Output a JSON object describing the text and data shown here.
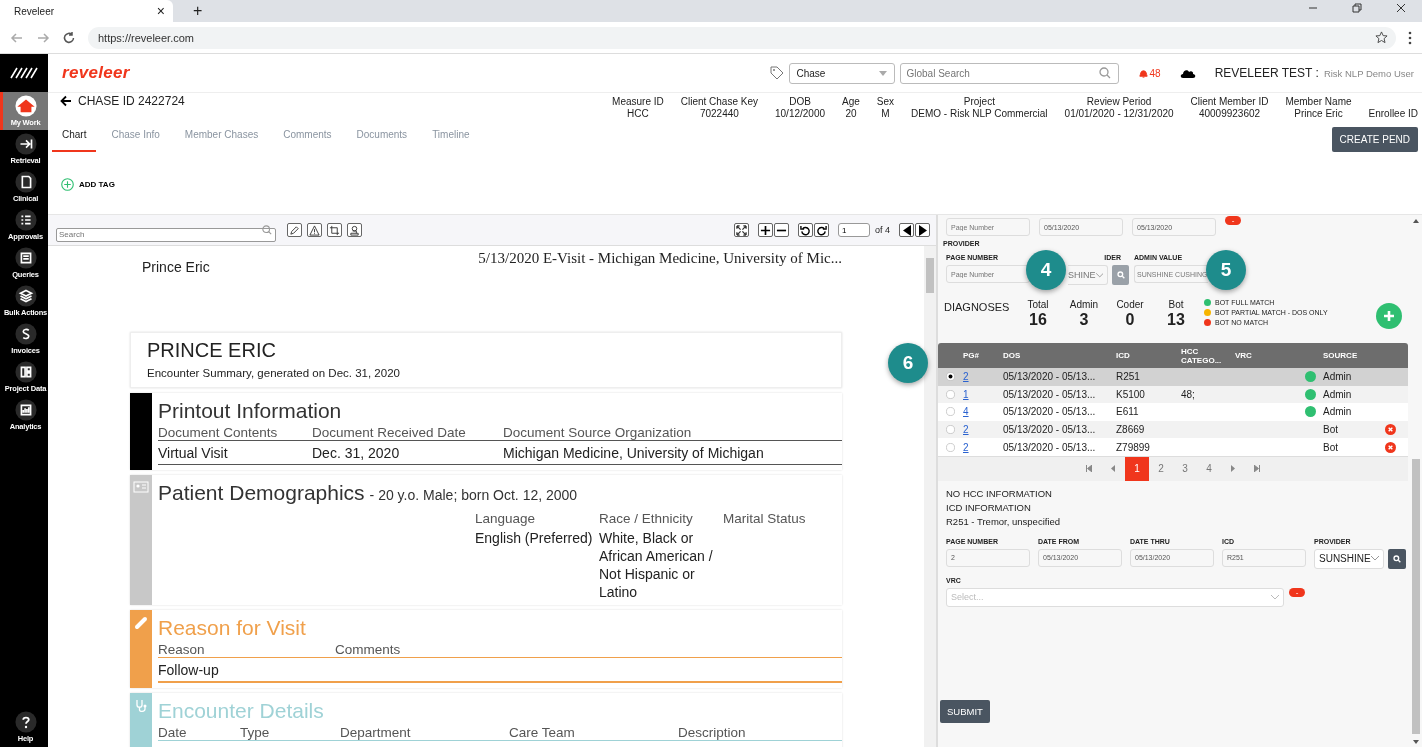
{
  "browser": {
    "tab_title": "Reveleer",
    "close": "×",
    "new_tab": "+",
    "url": "https://reveleer.com"
  },
  "sidebar": {
    "items": [
      {
        "label": "My Work",
        "selected": true
      },
      {
        "label": "Retrieval",
        "selected": false
      },
      {
        "label": "Clinical",
        "selected": false
      },
      {
        "label": "Approvals",
        "selected": false
      },
      {
        "label": "Queries",
        "selected": false
      },
      {
        "label": "Bulk Actions",
        "selected": false
      },
      {
        "label": "Invoices",
        "selected": false
      },
      {
        "label": "Project Data",
        "selected": false
      },
      {
        "label": "Analytics",
        "selected": false
      }
    ],
    "help": "Help"
  },
  "header": {
    "logo": "reveleer",
    "search_type": "Chase",
    "search_placeholder": "Global Search",
    "alert_count": "48",
    "user_org": "REVELEER TEST :",
    "user_name": "Risk NLP Demo User"
  },
  "chase": {
    "title": "CHASE ID 2422724",
    "meta": [
      {
        "label": "Measure ID",
        "value": "HCC"
      },
      {
        "label": "Client Chase Key",
        "value": "7022440"
      },
      {
        "label": "DOB",
        "value": "10/12/2000"
      },
      {
        "label": "Age",
        "value": "20"
      },
      {
        "label": "Sex",
        "value": "M"
      },
      {
        "label": "Project",
        "value": "DEMO - Risk NLP Commercial"
      },
      {
        "label": "Review Period",
        "value": "01/01/2020 - 12/31/2020"
      },
      {
        "label": "Client Member ID",
        "value": "40009923602"
      },
      {
        "label": "Member Name",
        "value": "Prince Eric"
      },
      {
        "label": "Enrollee ID"
      }
    ]
  },
  "tabs": [
    {
      "label": "Chart",
      "selected": true
    },
    {
      "label": "Chase Info",
      "selected": false
    },
    {
      "label": "Member Chases",
      "selected": false
    },
    {
      "label": "Comments",
      "selected": false
    },
    {
      "label": "Documents",
      "selected": false
    },
    {
      "label": "Timeline",
      "selected": false
    }
  ],
  "create_pend": "CREATE PEND",
  "add_tag": "ADD TAG",
  "viewer": {
    "search_placeholder": "Search",
    "page": "1",
    "page_total": "of 4"
  },
  "document": {
    "patient": "Prince Eric",
    "visit": "5/13/2020 E-Visit - Michigan Medicine, University of Mic...",
    "name": "PRINCE ERIC",
    "summary": "Encounter Summary, generated on Dec. 31, 2020",
    "sections": [
      {
        "kind": "printout",
        "title": "Printout Information",
        "color": "#000000",
        "headers": [
          "Document Contents",
          "Document Received Date",
          "Document Source Organization"
        ],
        "values": [
          "Virtual Visit",
          "Dec. 31, 2020",
          "Michigan Medicine, University of Michigan"
        ]
      },
      {
        "kind": "demographics",
        "title": "Patient Demographics",
        "subtitle": "- 20 y.o. Male; born Oct. 12, 2000",
        "color": "#c8c8c8",
        "headers": [
          "Language",
          "Race / Ethnicity",
          "Marital Status"
        ],
        "values": [
          "English (Preferred)",
          "White, Black or African American / Not Hispanic or Latino"
        ]
      },
      {
        "kind": "reason",
        "title": "Reason for Visit",
        "color": "#f0a04b",
        "headers": [
          "Reason",
          "Comments"
        ],
        "values": [
          "Follow-up"
        ]
      },
      {
        "kind": "encounter",
        "title": "Encounter Details",
        "color": "#9fd2d6",
        "headers": [
          "Date",
          "Type",
          "Department",
          "Care Team",
          "Description"
        ]
      }
    ]
  },
  "panel": {
    "top_fields": [
      {
        "placeholder": "Page Number"
      },
      {
        "value": "05/13/2020"
      },
      {
        "value": "05/13/2020"
      }
    ],
    "remove": "-",
    "provider_heading": "PROVIDER",
    "admin": {
      "page_label": "PAGE NUMBER",
      "page_placeholder": "Page Number",
      "provider_label": "IDER",
      "provider_value": "SHINE",
      "admin_label": "ADMIN VALUE",
      "admin_value": "SUNSHINE CUSHING"
    },
    "diagnoses": {
      "title": "DIAGNOSES",
      "counts": [
        {
          "label": "Total",
          "value": "16"
        },
        {
          "label": "Admin",
          "value": "3"
        },
        {
          "label": "Coder",
          "value": "0"
        },
        {
          "label": "Bot",
          "value": "13"
        }
      ],
      "legend": [
        {
          "label": "BOT FULL MATCH",
          "color": "#2fbf71"
        },
        {
          "label": "BOT PARTIAL MATCH - DOS ONLY",
          "color": "#f7b500"
        },
        {
          "label": "BOT NO MATCH",
          "color": "#f0361c"
        }
      ]
    },
    "table": {
      "columns": [
        "PG#",
        "DOS",
        "ICD",
        "HCC CATEGO...",
        "VRC",
        "SOURCE"
      ],
      "rows": [
        {
          "selected": true,
          "page": "2",
          "dos": "05/13/2020 - 05/13...",
          "icd": "R251",
          "color": "#2fbf71",
          "source": "Admin",
          "delete": false
        },
        {
          "selected": false,
          "page": "1",
          "dos": "05/13/2020 - 05/13...",
          "icd": "K5100",
          "hcc": "48;",
          "color": "#2fbf71",
          "source": "Admin",
          "delete": false
        },
        {
          "selected": false,
          "page": "4",
          "dos": "05/13/2020 - 05/13...",
          "icd": "E611",
          "color": "#2fbf71",
          "source": "Admin",
          "delete": false
        },
        {
          "selected": false,
          "page": "2",
          "dos": "05/13/2020 - 05/13...",
          "icd": "Z8669",
          "source": "Bot",
          "delete": true
        },
        {
          "selected": false,
          "page": "2",
          "dos": "05/13/2020 - 05/13...",
          "icd": "Z79899",
          "source": "Bot",
          "delete": true
        }
      ]
    },
    "pages": [
      {
        "label": "1",
        "selected": true
      },
      {
        "label": "2",
        "selected": false
      },
      {
        "label": "3",
        "selected": false
      },
      {
        "label": "4",
        "selected": false
      }
    ],
    "info": [
      "NO HCC INFORMATION",
      "ICD INFORMATION",
      "R251 - Tremor, unspecified"
    ],
    "form": {
      "fields": [
        {
          "label": "PAGE NUMBER",
          "value": "2"
        },
        {
          "label": "DATE FROM",
          "value": "05/13/2020"
        },
        {
          "label": "DATE THRU",
          "value": "05/13/2020"
        },
        {
          "label": "ICD",
          "value": "R251"
        }
      ],
      "provider_label": "PROVIDER",
      "provider_value": "SUNSHINE",
      "vrc_label": "VRC",
      "vrc_placeholder": "Select...",
      "remove": "-"
    },
    "submit": "SUBMIT"
  },
  "callouts": [
    "4",
    "5",
    "6"
  ]
}
